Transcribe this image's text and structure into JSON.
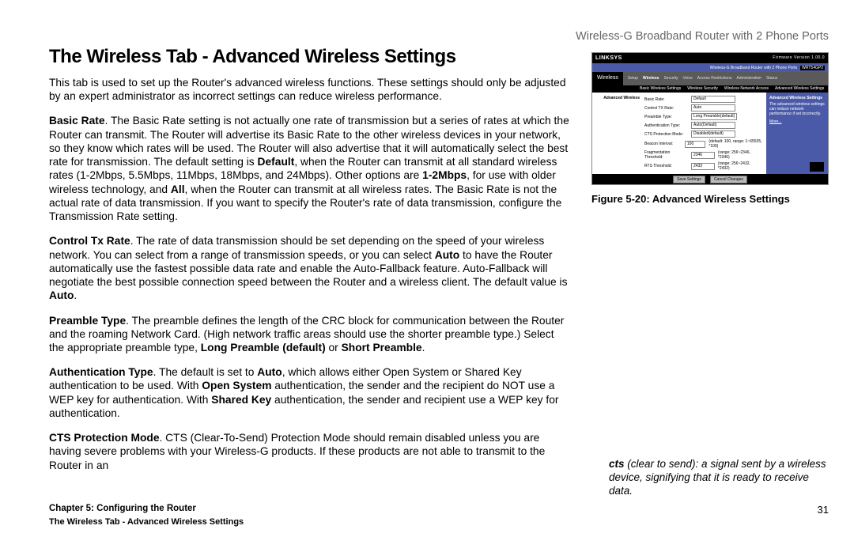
{
  "header": {
    "product": "Wireless-G Broadband Router with 2 Phone Ports"
  },
  "heading": "The Wireless Tab - Advanced Wireless Settings",
  "paras": {
    "intro": "This tab is used to set up the Router's advanced wireless functions. These settings should only be adjusted by an expert administrator as incorrect settings can reduce wireless performance.",
    "basic_rate_label": "Basic Rate",
    "basic_rate_1": ". The Basic Rate setting is not actually one rate of transmission but a series of rates at which the Router can transmit. The Router will advertise its Basic Rate to the other wireless devices in your network, so they know which rates will be used. The Router will also advertise that it will automatically select the best rate for transmission. The default setting is ",
    "basic_rate_b1": "Default",
    "basic_rate_2": ", when the Router can transmit at all standard wireless rates (1-2Mbps, 5.5Mbps, 11Mbps, 18Mbps, and 24Mbps). Other options are ",
    "basic_rate_b2": "1-2Mbps",
    "basic_rate_3": ", for use with older wireless technology, and ",
    "basic_rate_b3": "All",
    "basic_rate_4": ", when the Router can transmit at all wireless rates. The Basic Rate is not the actual rate of data transmission. If you want to specify the Router's rate of data transmission, configure the Transmission Rate setting.",
    "ctrl_tx_label": "Control Tx Rate",
    "ctrl_tx_1": ". The rate of data transmission should be set depending on the speed of your wireless network. You can select from a range of transmission speeds, or you can select ",
    "ctrl_tx_b1": "Auto",
    "ctrl_tx_2": " to have the Router automatically use the fastest possible data rate and enable the Auto-Fallback feature. Auto-Fallback will negotiate the best possible connection speed between the Router and a wireless client. The default value is ",
    "ctrl_tx_b2": "Auto",
    "ctrl_tx_3": ".",
    "preamble_label": "Preamble Type",
    "preamble_1": ". The preamble defines the length of the CRC block for communication between the Router and the roaming Network Card. (High network traffic areas should use the shorter preamble type.) Select the appropriate preamble type, ",
    "preamble_b1": "Long Preamble (default)",
    "preamble_2": " or ",
    "preamble_b2": "Short Preamble",
    "preamble_3": ".",
    "auth_label": "Authentication Type",
    "auth_1": ". The default is set to ",
    "auth_b1": "Auto",
    "auth_2": ", which allows either Open System or Shared Key authentication to be used. With ",
    "auth_b2": "Open System",
    "auth_3": " authentication, the sender and the recipient do NOT use a WEP key for authentication. With ",
    "auth_b3": "Shared Key",
    "auth_4": " authentication, the sender and recipient use a WEP key for authentication.",
    "cts_label": "CTS Protection Mode",
    "cts_1": ". CTS (Clear-To-Send) Protection Mode should remain disabled unless you are having severe problems with your Wireless-G products. If these products are not able to transmit to the Router in an"
  },
  "figure": {
    "brand": "LINKSYS",
    "fw": "Firmware Version 1.00.0",
    "title_band": "Wireless-G Broadband Router with 2 Phone Ports",
    "model": "WRT54GP2",
    "section": "Wireless",
    "tabs": [
      "Setup",
      "Wireless",
      "Security",
      "Voice",
      "Access Restrictions",
      "Administration",
      "Status"
    ],
    "subtabs": [
      "Basic Wireless Settings",
      "Wireless Security",
      "Wireless Network Access",
      "Advanced Wireless Settings"
    ],
    "side_heading": "Advanced Wireless Settings",
    "side_text": "The advanced wireless settings can reduce network performance if set incorrectly.",
    "side_more": "More...",
    "group": "Advanced Wireless",
    "rows": [
      {
        "label": "Basic Rate:",
        "field": "Default",
        "type": "sel"
      },
      {
        "label": "Control TX Rate:",
        "field": "Auto",
        "type": "sel"
      },
      {
        "label": "Preamble Type:",
        "field": "Long Preamble(default)",
        "type": "sel"
      },
      {
        "label": "Authentication Type:",
        "field": "Auto(Default)",
        "type": "sel"
      },
      {
        "label": "CTS Protection Mode:",
        "field": "Disabled(default)",
        "type": "sel"
      },
      {
        "label": "Beacon Interval:",
        "field": "100",
        "type": "inp",
        "hint": "(default: 100, range: 1~65535, *100)"
      },
      {
        "label": "Fragmentation Threshold:",
        "field": "2346",
        "type": "inp",
        "hint": "(range: 256~2346, *2346)"
      },
      {
        "label": "RTS Threshold:",
        "field": "2433",
        "type": "inp",
        "hint": "(range: 256~2432, *2432)"
      }
    ],
    "btn_save": "Save Settings",
    "btn_cancel": "Cancel Changes",
    "caption": "Figure 5-20: Advanced Wireless Settings"
  },
  "glossary": {
    "term": "cts",
    "def": " (clear to send): a signal sent by a wireless device, signifying that it is ready to receive data."
  },
  "footer": {
    "chapter": "Chapter 5: Configuring the Router",
    "section": "The Wireless Tab - Advanced Wireless Settings",
    "page": "31"
  }
}
